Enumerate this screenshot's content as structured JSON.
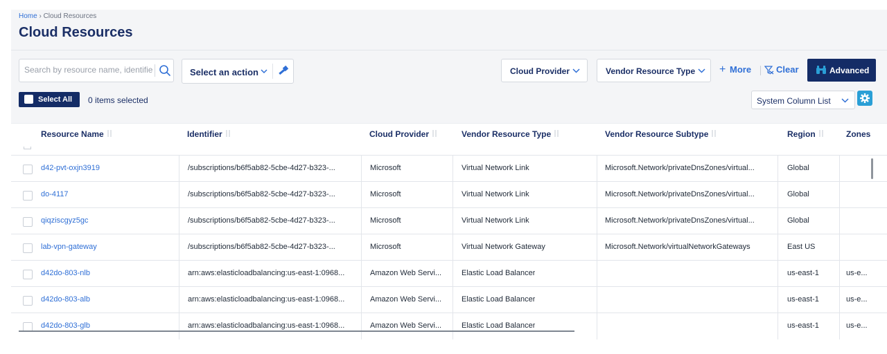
{
  "breadcrumb": {
    "home": "Home",
    "separator": " › ",
    "current": "Cloud Resources"
  },
  "page_title": "Cloud Resources",
  "search": {
    "placeholder": "Search by resource name, identifier"
  },
  "action_select": {
    "label": "Select an action"
  },
  "filters": {
    "cloud_provider": "Cloud Provider",
    "vendor_resource_type": "Vendor Resource Type",
    "more": "More",
    "clear": "Clear",
    "advanced": "Advanced"
  },
  "selection": {
    "select_all": "Select All",
    "items_selected": "0 items selected"
  },
  "column_list": {
    "label": "System Column List"
  },
  "columns": {
    "resource_name": "Resource Name",
    "identifier": "Identifier",
    "cloud_provider": "Cloud Provider",
    "vendor_resource_type": "Vendor Resource Type",
    "vendor_resource_subtype": "Vendor Resource Subtype",
    "region": "Region",
    "zones": "Zones"
  },
  "rows": [
    {
      "name": "d42-pvt-oxjn3919",
      "identifier": "/subscriptions/b6f5ab82-5cbe-4d27-b323-...",
      "provider": "Microsoft",
      "type": "Virtual Network Link",
      "subtype": "Microsoft.Network/privateDnsZones/virtual...",
      "region": "Global",
      "zones": ""
    },
    {
      "name": "do-4117",
      "identifier": "/subscriptions/b6f5ab82-5cbe-4d27-b323-...",
      "provider": "Microsoft",
      "type": "Virtual Network Link",
      "subtype": "Microsoft.Network/privateDnsZones/virtual...",
      "region": "Global",
      "zones": ""
    },
    {
      "name": "qiqziscgyz5gc",
      "identifier": "/subscriptions/b6f5ab82-5cbe-4d27-b323-...",
      "provider": "Microsoft",
      "type": "Virtual Network Link",
      "subtype": "Microsoft.Network/privateDnsZones/virtual...",
      "region": "Global",
      "zones": ""
    },
    {
      "name": "lab-vpn-gateway",
      "identifier": "/subscriptions/b6f5ab82-5cbe-4d27-b323-...",
      "provider": "Microsoft",
      "type": "Virtual Network Gateway",
      "subtype": "Microsoft.Network/virtualNetworkGateways",
      "region": "East US",
      "zones": ""
    },
    {
      "name": "d42do-803-nlb",
      "identifier": "arn:aws:elasticloadbalancing:us-east-1:0968...",
      "provider": "Amazon Web Servi...",
      "type": "Elastic Load Balancer",
      "subtype": "",
      "region": "us-east-1",
      "zones": "us-e..."
    },
    {
      "name": "d42do-803-alb",
      "identifier": "arn:aws:elasticloadbalancing:us-east-1:0968...",
      "provider": "Amazon Web Servi...",
      "type": "Elastic Load Balancer",
      "subtype": "",
      "region": "us-east-1",
      "zones": "us-e..."
    },
    {
      "name": "d42do-803-glb",
      "identifier": "arn:aws:elasticloadbalancing:us-east-1:0968...",
      "provider": "Amazon Web Servi...",
      "type": "Elastic Load Balancer",
      "subtype": "",
      "region": "us-east-1",
      "zones": "us-e..."
    }
  ],
  "colors": {
    "navy": "#142c66",
    "link": "#2f6fd6",
    "gear": "#2a9fd6",
    "toolbar_bg": "#f4f5f7"
  }
}
